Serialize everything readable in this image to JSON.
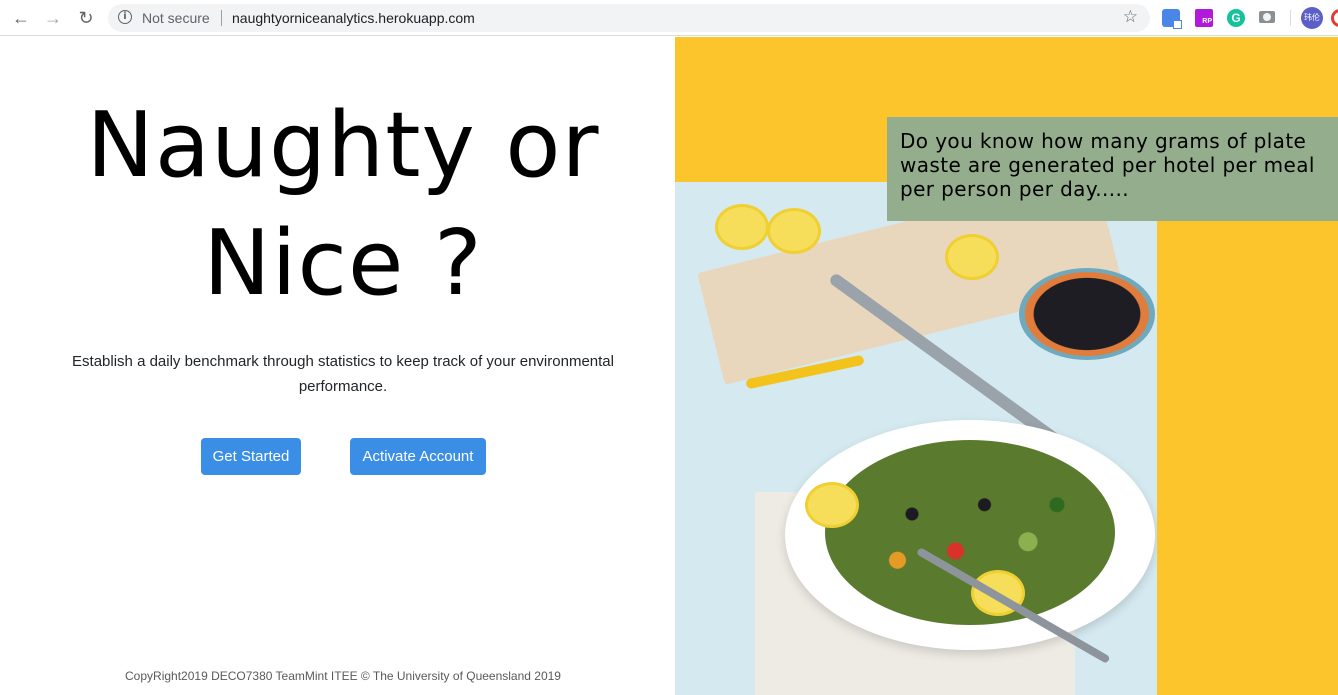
{
  "browser": {
    "security_label": "Not secure",
    "url": "naughtyorniceanalytics.herokuapp.com",
    "info_glyph": "i",
    "extensions": [
      {
        "name": "google-translate-icon"
      },
      {
        "name": "rp-extension-icon",
        "label": "RP"
      },
      {
        "name": "grammarly-icon",
        "label": "G"
      },
      {
        "name": "screenshot-camera-icon"
      }
    ],
    "profile_label": "玮伦",
    "nav_icons": {
      "back": "←",
      "forward": "→",
      "reload": "↻",
      "star": "☆"
    }
  },
  "hero": {
    "title_line1": "Naughty or",
    "title_line2": "Nice ?",
    "tagline": "Establish a daily benchmark through statistics to keep track of your environmental performance."
  },
  "actions": {
    "get_started": "Get Started",
    "activate_account": "Activate Account"
  },
  "footer": {
    "copyright": "CopyRight2019 DECO7380 TeamMint ITEE © The University of Queensland 2019"
  },
  "promo": {
    "question": "Do you know how many grams of plate waste are generated per hotel per meal per person per day.....",
    "colors": {
      "panel": "#fdc52c",
      "callout": "#94ad8c",
      "button": "#3a8ee6"
    }
  }
}
